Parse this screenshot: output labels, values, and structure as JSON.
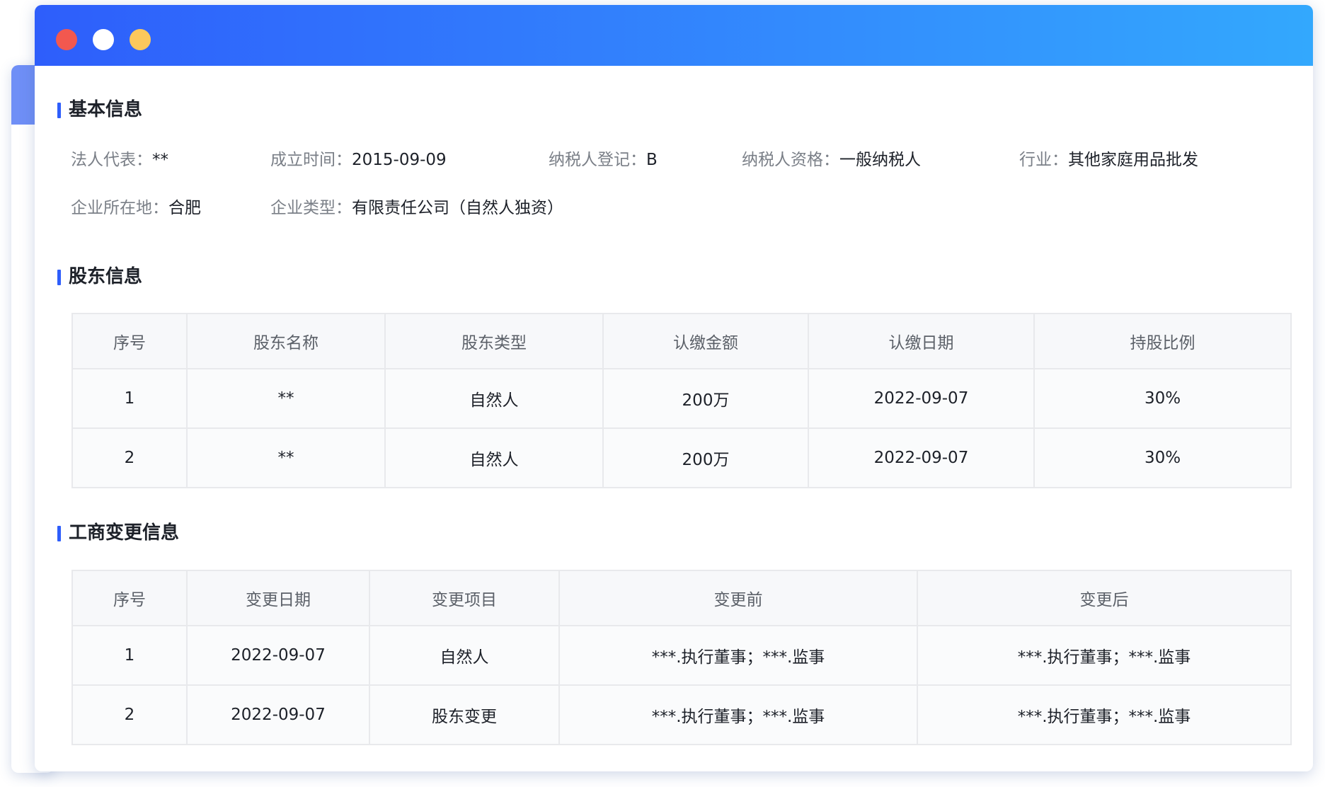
{
  "window": {
    "controls": [
      "close-dot",
      "minimize-dot",
      "maximize-dot"
    ],
    "colors": {
      "close": "#f2584f",
      "minimize": "#ffffff",
      "maximize": "#fcc85c",
      "accent": "#2e5efb"
    }
  },
  "basic": {
    "title": "基本信息",
    "legal_rep": {
      "label": "法人代表：",
      "value": "**"
    },
    "established": {
      "label": "成立时间：",
      "value": "2015-09-09"
    },
    "tax_reg": {
      "label": "纳税人登记：",
      "value": "B"
    },
    "tax_qual": {
      "label": "纳税人资格：",
      "value": "一般纳税人"
    },
    "industry": {
      "label": "行业：",
      "value": "其他家庭用品批发"
    },
    "location": {
      "label": "企业所在地：",
      "value": "合肥"
    },
    "company_type": {
      "label": "企业类型：",
      "value": "有限责任公司（自然人独资）"
    }
  },
  "shareholders": {
    "title": "股东信息",
    "headers": [
      "序号",
      "股东名称",
      "股东类型",
      "认缴金额",
      "认缴日期",
      "持股比例"
    ],
    "rows": [
      [
        "1",
        "**",
        "自然人",
        "200万",
        "2022-09-07",
        "30%"
      ],
      [
        "2",
        "**",
        "自然人",
        "200万",
        "2022-09-07",
        "30%"
      ]
    ]
  },
  "changes": {
    "title": "工商变更信息",
    "headers": [
      "序号",
      "变更日期",
      "变更项目",
      "变更前",
      "变更后"
    ],
    "rows": [
      [
        "1",
        "2022-09-07",
        "自然人",
        "***.执行董事；***.监事",
        "***.执行董事；***.监事"
      ],
      [
        "2",
        "2022-09-07",
        "股东变更",
        "***.执行董事；***.监事",
        "***.执行董事；***.监事"
      ]
    ]
  }
}
